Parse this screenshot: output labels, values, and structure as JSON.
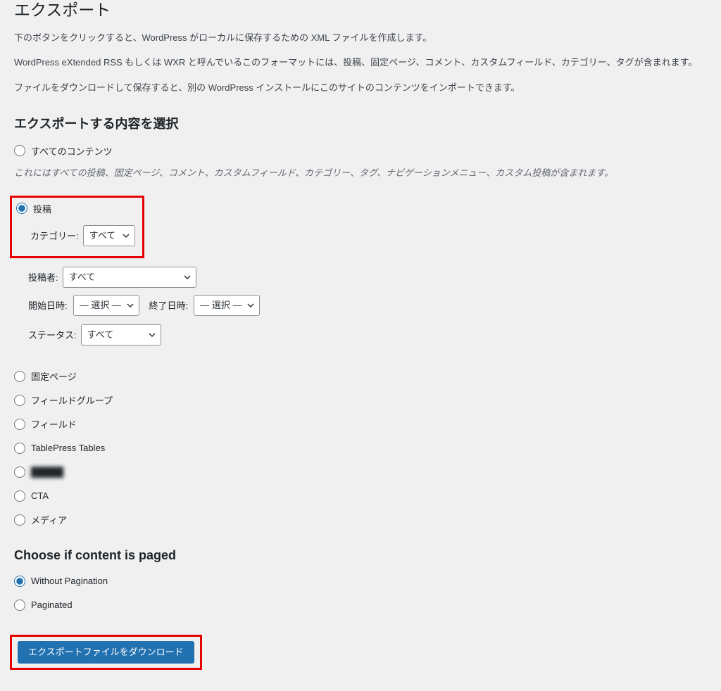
{
  "page": {
    "title": "エクスポート",
    "desc1": "下のボタンをクリックすると、WordPress がローカルに保存するための XML ファイルを作成します。",
    "desc2": "WordPress eXtended RSS もしくは WXR と呼んでいるこのフォーマットには、投稿、固定ページ、コメント、カスタムフィールド、カテゴリー、タグが含まれます。",
    "desc3": "ファイルをダウンロードして保存すると、別の WordPress インストールにこのサイトのコンテンツをインポートできます。"
  },
  "section_choose": {
    "title": "エクスポートする内容を選択",
    "all_content_label": "すべてのコンテンツ",
    "all_content_note": "これにはすべての投稿、固定ページ、コメント、カスタムフィールド、カテゴリー、タグ、ナビゲーションメニュー、カスタム投稿が含まれます。"
  },
  "posts": {
    "label": "投稿",
    "category_label": "カテゴリー:",
    "category_value": "すべて",
    "author_label": "投稿者:",
    "author_value": "すべて",
    "start_label": "開始日時:",
    "start_value": "— 選択 —",
    "end_label": "終了日時:",
    "end_value": "— 選択 —",
    "status_label": "ステータス:",
    "status_value": "すべて"
  },
  "other_types": {
    "pages": "固定ページ",
    "field_groups": "フィールドグループ",
    "fields": "フィールド",
    "tablepress": "TablePress Tables",
    "redacted": "█████",
    "cta": "CTA",
    "media": "メディア"
  },
  "pagination": {
    "title": "Choose if content is paged",
    "without": "Without Pagination",
    "paginated": "Paginated"
  },
  "button": {
    "download": "エクスポートファイルをダウンロード"
  }
}
